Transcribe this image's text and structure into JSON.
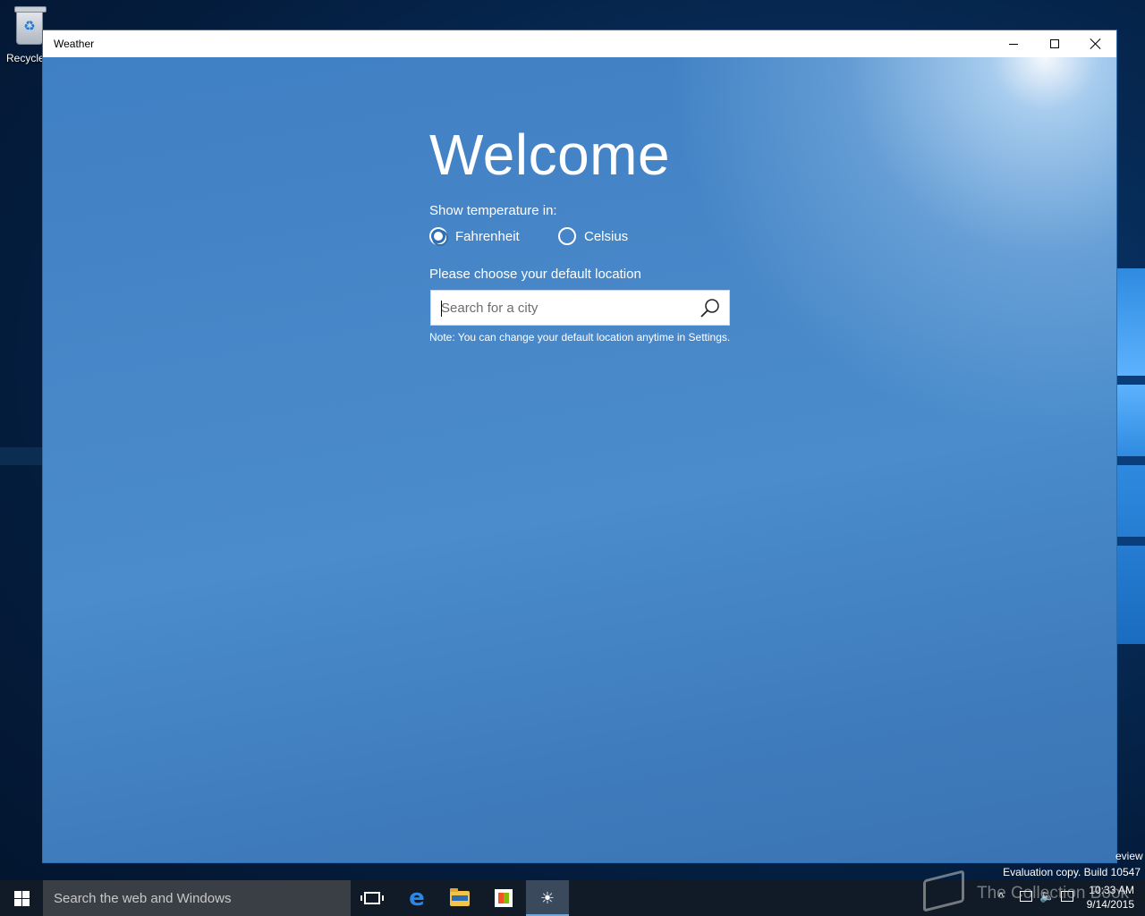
{
  "desktop": {
    "recycle_bin_label": "Recycle",
    "eval_line": "Evaluation copy. Build 10547",
    "preview_fragment": "eview",
    "watermark_text": "The Collection Book"
  },
  "window": {
    "title": "Weather"
  },
  "welcome": {
    "heading": "Welcome",
    "temperature_label": "Show temperature in:",
    "options": [
      "Fahrenheit",
      "Celsius"
    ],
    "selected_option": "Fahrenheit",
    "location_label": "Please choose your default location",
    "search_placeholder": "Search for a city",
    "note": "Note: You can change your default location anytime in Settings."
  },
  "taskbar": {
    "search_placeholder": "Search the web and Windows",
    "apps": [
      "task-view",
      "edge",
      "file-explorer",
      "store",
      "weather"
    ],
    "active_app": "weather",
    "time": "10:33 AM",
    "date": "9/14/2015"
  },
  "colors": {
    "accent": "#4a8ccc",
    "taskbar": "#101b27"
  }
}
